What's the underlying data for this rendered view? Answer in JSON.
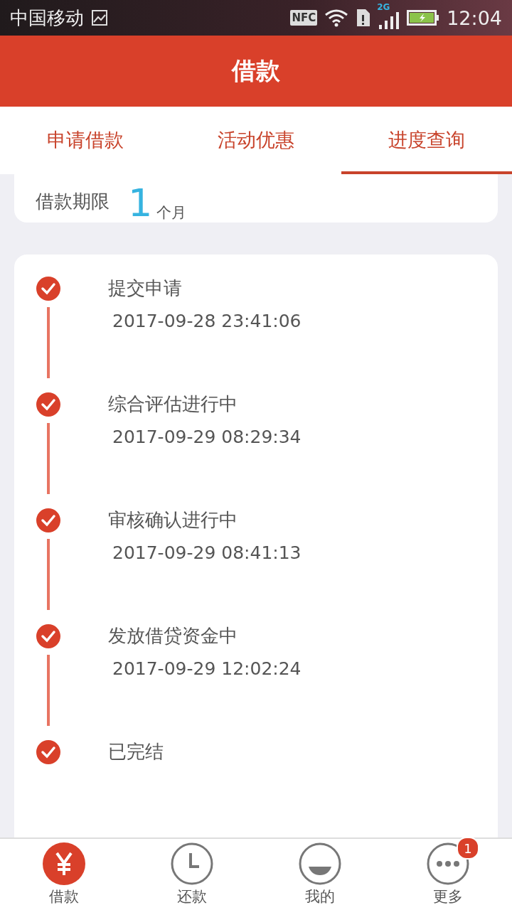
{
  "status_bar": {
    "carrier": "中国移动",
    "nfc": "NFC",
    "network": "2G",
    "time": "12:04"
  },
  "header": {
    "title": "借款"
  },
  "tabs": [
    {
      "label": "申请借款",
      "selected": false
    },
    {
      "label": "活动优惠",
      "selected": false
    },
    {
      "label": "进度查询",
      "selected": true
    }
  ],
  "loan_card": {
    "term_label": "借款期限",
    "term_value": "1",
    "term_unit": "个月"
  },
  "progress": [
    {
      "title": "提交申请",
      "time": "2017-09-28 23:41:06",
      "completed": true
    },
    {
      "title": "综合评估进行中",
      "time": "2017-09-29 08:29:34",
      "completed": true
    },
    {
      "title": "审核确认进行中",
      "time": "2017-09-29 08:41:13",
      "completed": true
    },
    {
      "title": "发放借贷资金中",
      "time": "2017-09-29 12:02:24",
      "completed": true
    },
    {
      "title": "已完结",
      "completed": true
    }
  ],
  "bottom_nav": [
    {
      "label": "借款",
      "kind": "yen",
      "selected": true
    },
    {
      "label": "还款",
      "kind": "clock",
      "selected": false
    },
    {
      "label": "我的",
      "kind": "smile",
      "selected": false
    },
    {
      "label": "更多",
      "kind": "more",
      "selected": false,
      "badge": "1"
    }
  ]
}
